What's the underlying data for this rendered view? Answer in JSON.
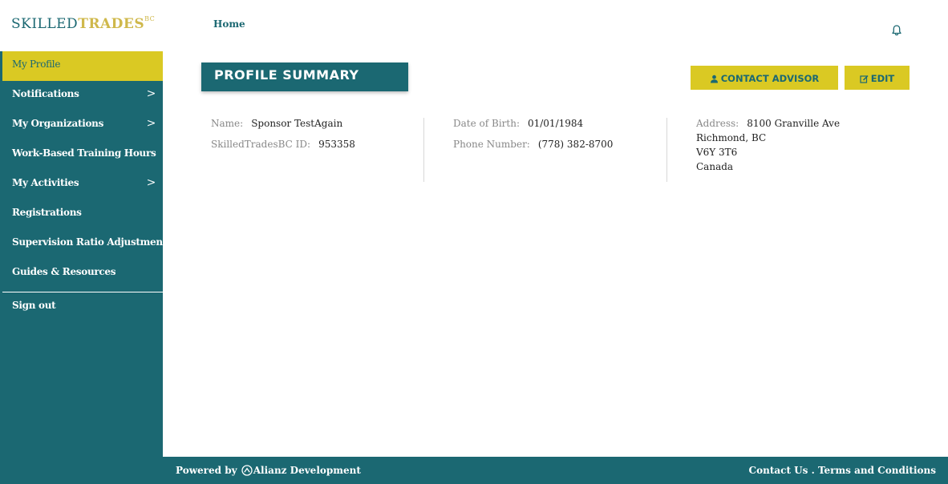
{
  "logo": {
    "skilled": "SKILLED",
    "trades": "TRADES",
    "bc": "BC"
  },
  "sidebar": {
    "items": [
      {
        "label": "My Profile",
        "has_submenu": false,
        "active": true
      },
      {
        "label": "Notifications",
        "has_submenu": true
      },
      {
        "label": "My Organizations",
        "has_submenu": true
      },
      {
        "label": "Work-Based Training Hours",
        "has_submenu": false
      },
      {
        "label": "My Activities",
        "has_submenu": true
      },
      {
        "label": "Registrations",
        "has_submenu": false
      },
      {
        "label": "Supervision Ratio Adjustment",
        "has_submenu": false
      },
      {
        "label": "Guides & Resources",
        "has_submenu": false
      }
    ],
    "signout": "Sign out",
    "chevron": ">"
  },
  "header": {
    "breadcrumb": "Home",
    "bell_icon": "bell-icon"
  },
  "main": {
    "title": "PROFILE SUMMARY",
    "buttons": {
      "contact_advisor": "CONTACT ADVISOR",
      "edit": "EDIT"
    },
    "profile": {
      "name_label": "Name:",
      "name_value": "Sponsor TestAgain",
      "id_label": "SkilledTradesBC ID:",
      "id_value": "953358",
      "dob_label": "Date of Birth:",
      "dob_value": "01/01/1984",
      "phone_label": "Phone Number:",
      "phone_value": "(778) 382-8700",
      "address_label": "Address:",
      "address_lines": [
        "8100 Granville Ave",
        "Richmond, BC",
        "V6Y 3T6",
        "Canada"
      ]
    }
  },
  "footer": {
    "powered_by": "Powered by",
    "company": "Alianz Development",
    "contact": "Contact Us",
    "separator": ".",
    "terms": "Terms and Conditions"
  },
  "colors": {
    "primary": "#1b6872",
    "accent": "#dac923",
    "logo_gold": "#cfb84b"
  }
}
